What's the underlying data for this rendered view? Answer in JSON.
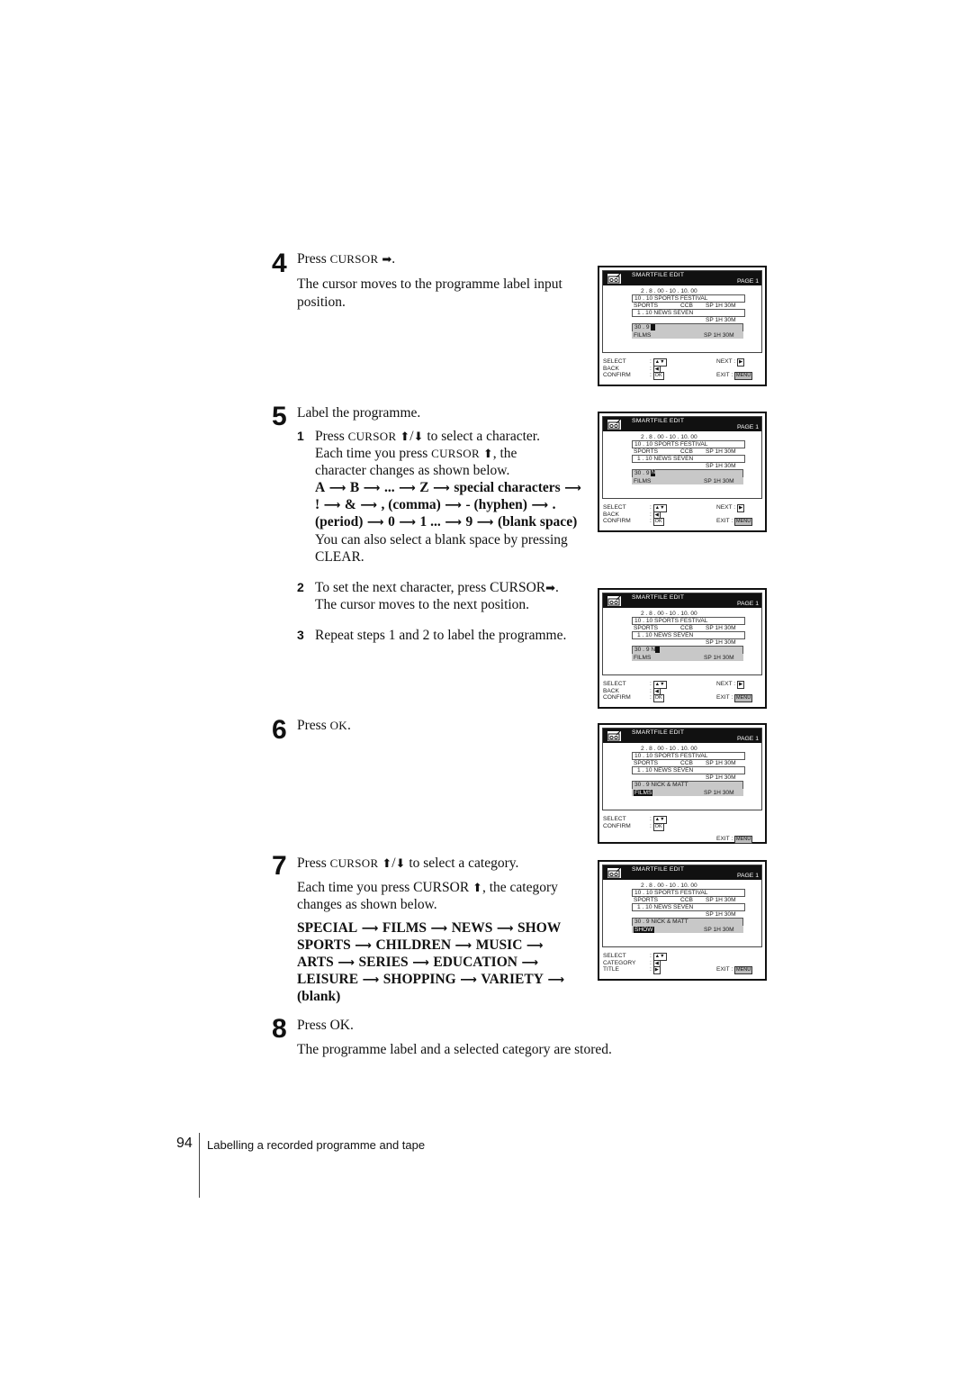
{
  "page": {
    "number": "94",
    "section_title": "Labelling a recorded programme and tape"
  },
  "icons": {
    "arrow_right": "➡",
    "arrow_up": "⬆",
    "arrow_down": "⬇",
    "chain_arrow": "⟶"
  },
  "steps": {
    "s4": {
      "num": "4",
      "line1_pre": "Press ",
      "line1_cursor": "CURSOR",
      "line1_post": ".",
      "body_line1": "The cursor moves to the programme label input",
      "body_line2": "position."
    },
    "s5": {
      "num": "5",
      "title": "Label the programme.",
      "sub1": {
        "num": "1",
        "l1_pre": "Press ",
        "l1_cursor": "CURSOR",
        "l1_post": " to select a character.",
        "l2_pre": "Each time you press ",
        "l2_cursor": "CURSOR",
        "l2_post": ", the",
        "l3": "character changes as shown below.",
        "chain": [
          [
            "A",
            "B",
            "...",
            "Z",
            "special characters",
            ""
          ],
          [
            "!",
            "&",
            ", (comma)",
            "- (hyphen)",
            "."
          ],
          [
            "(period)",
            "0",
            "1 ...",
            "9",
            "(blank space)"
          ]
        ],
        "l7": "You can also select a blank space by pressing",
        "l8": "CLEAR."
      },
      "sub2": {
        "num": "2",
        "l1": "To set the next character, press CURSOR",
        "l1_post": ".",
        "l2": "The cursor moves to the next position."
      },
      "sub3": {
        "num": "3",
        "l1": "Repeat steps 1 and 2 to label the programme."
      }
    },
    "s6": {
      "num": "6",
      "pre": "Press ",
      "ok": "OK",
      "post": "."
    },
    "s7": {
      "num": "7",
      "l1_pre": "Press ",
      "l1_cursor": "CURSOR",
      "l1_post": " to select a category.",
      "l2_pre": "Each time you press CURSOR ",
      "l2_post": ", the category",
      "l3": "changes as shown below.",
      "categories": [
        "SPECIAL",
        "FILMS",
        "NEWS",
        "SHOW",
        "SPORTS",
        "CHILDREN",
        "MUSIC",
        "ARTS",
        "SERIES",
        "EDUCATION",
        "LEISURE",
        "SHOPPING",
        "VARIETY",
        "(blank)"
      ]
    },
    "s8": {
      "num": "8",
      "l1": "Press OK.",
      "l2": "The programme label and a selected category are stored."
    }
  },
  "osd_screens": [
    {
      "title": "SMARTFILE  EDIT",
      "page": "PAGE 1",
      "row1": "2 .  8 . 00 - 10 . 10. 00",
      "row2": "10 . 10   SPORTS   FESTIVAL",
      "row3_left": "SPORTS",
      "row3_mid": "CCB",
      "row3_right": "SP  1H 30M",
      "row4": "1 . 10   NEWS   SEVEN",
      "row5": "SP  1H 30M",
      "row6_date": "30 .  9",
      "row6_label": "",
      "cursor_char": "",
      "row7_cat": "FILMS",
      "row7_right": "SP  1H 30M",
      "cat_highlight": false,
      "foot_left": [
        "SELECT",
        "BACK",
        "CONFIRM"
      ],
      "foot_keys": [
        "▲▼",
        "◀",
        "OK"
      ],
      "next_label": "NEXT :",
      "exit_label": "EXIT   :",
      "menu_key": "MENU"
    },
    {
      "title": "SMARTFILE  EDIT",
      "page": "PAGE 1",
      "row1": "2 .  8 . 00 - 10 . 10. 00",
      "row2": "10 . 10   SPORTS   FESTIVAL",
      "row3_left": "SPORTS",
      "row3_mid": "CCB",
      "row3_right": "SP  1H 30M",
      "row4": "1 . 10   NEWS   SEVEN",
      "row5": "SP  1H 30M",
      "row6_date": "30 .  9",
      "row6_label": "",
      "cursor_char": "N",
      "row7_cat": "FILMS",
      "row7_right": "SP  1H 30M",
      "cat_highlight": false,
      "foot_left": [
        "SELECT",
        "BACK",
        "CONFIRM"
      ],
      "foot_keys": [
        "▲▼",
        "◀",
        "OK"
      ],
      "next_label": "NEXT :",
      "exit_label": "EXIT   :",
      "menu_key": "MENU"
    },
    {
      "title": "SMARTFILE  EDIT",
      "page": "PAGE 1",
      "row1": "2 .  8 . 00 - 10 . 10. 00",
      "row2": "10 . 10   SPORTS   FESTIVAL",
      "row3_left": "SPORTS",
      "row3_mid": "CCB",
      "row3_right": "SP  1H 30M",
      "row4": "1 . 10   NEWS   SEVEN",
      "row5": "SP  1H 30M",
      "row6_date": "30 .  9",
      "row6_label": "N",
      "cursor_char": "",
      "row7_cat": "FILMS",
      "row7_right": "SP  1H 30M",
      "cat_highlight": false,
      "foot_left": [
        "SELECT",
        "BACK",
        "CONFIRM"
      ],
      "foot_keys": [
        "▲▼",
        "◀",
        "OK"
      ],
      "next_label": "NEXT :",
      "exit_label": "EXIT   :",
      "menu_key": "MENU"
    },
    {
      "title": "SMARTFILE  EDIT",
      "page": "PAGE 1",
      "row1": "2 .  8 . 00 - 10 . 10. 00",
      "row2": "10 . 10   SPORTS   FESTIVAL",
      "row3_left": "SPORTS",
      "row3_mid": "CCB",
      "row3_right": "SP  1H 30M",
      "row4": "1 . 10   NEWS   SEVEN",
      "row5": "SP  1H 30M",
      "row6_date": "30 .  9",
      "row6_label": "NICK & MATT",
      "cursor_char": "",
      "row7_cat": "FILMS",
      "row7_right": "SP  1H 30M",
      "cat_highlight": true,
      "foot_left": [
        "SELECT",
        "CONFIRM"
      ],
      "foot_keys": [
        "▲▼",
        "OK"
      ],
      "next_label": "",
      "exit_label": "EXIT   :",
      "menu_key": "MENU"
    },
    {
      "title": "SMARTFILE  EDIT",
      "page": "PAGE 1",
      "row1": "2 .  8 . 00 - 10 . 10. 00",
      "row2": "10 . 10   SPORTS   FESTIVAL",
      "row3_left": "SPORTS",
      "row3_mid": "CCB",
      "row3_right": "SP  1H 30M",
      "row4": "1 . 10   NEWS   SEVEN",
      "row5": "SP  1H 30M",
      "row6_date": "30 .  9",
      "row6_label": "NICK & MATT",
      "cursor_char": "",
      "row7_cat": "SHOW",
      "row7_right": "SP  1H 30M",
      "cat_highlight": true,
      "foot_left": [
        "SELECT",
        "CATEGORY",
        "TITLE"
      ],
      "foot_keys": [
        "▲▼",
        "◀",
        "▶"
      ],
      "next_label": "",
      "exit_label": "EXIT   :",
      "menu_key": "MENU"
    }
  ]
}
